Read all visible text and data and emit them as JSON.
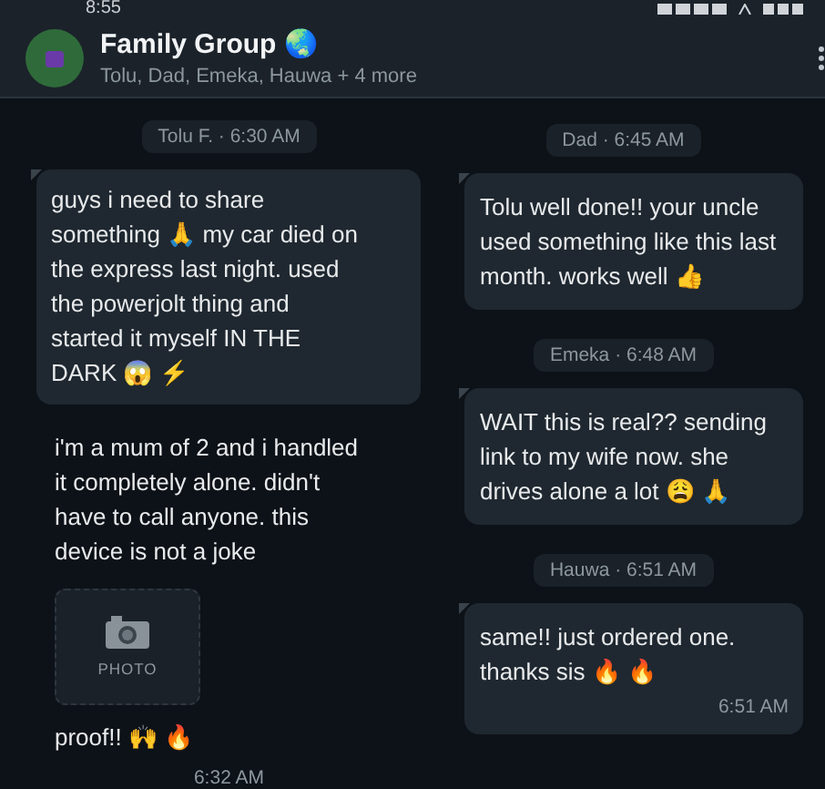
{
  "status_bar": {
    "time": "8:55"
  },
  "header": {
    "title": "Family Group 🌏",
    "subtitle": "Tolu, Dad, Emeka, Hauwa + 4 more"
  },
  "columns": [
    {
      "items": [
        {
          "kind": "stamp",
          "text": "Tolu F. · 6:30 AM"
        },
        {
          "kind": "bubble",
          "text": "guys i need to share something 🙏 my car died on the express last night. used the powerjolt thing and started it myself IN THE DARK 😱 ⚡"
        },
        {
          "kind": "text",
          "text": "i'm a mum of 2 and i handled it completely alone. didn't have to call anyone. this device is not a joke"
        },
        {
          "kind": "photo",
          "text": "PHOTO"
        },
        {
          "kind": "text",
          "text": "proof!! 🙌 🔥"
        },
        {
          "kind": "time",
          "text": "6:32 AM"
        }
      ]
    },
    {
      "items": [
        {
          "kind": "stamp",
          "text": "Dad · 6:45 AM"
        },
        {
          "kind": "bubble",
          "text": "Tolu well done!! your uncle used something like this last month. works well 👍"
        },
        {
          "kind": "stamp",
          "text": "Emeka · 6:48 AM"
        },
        {
          "kind": "bubble",
          "text": "WAIT this is real?? sending link to my wife now. she drives alone a lot 😩 🙏"
        },
        {
          "kind": "stamp",
          "text": "Hauwa · 6:51 AM"
        },
        {
          "kind": "bubble",
          "text": "same!! just ordered one. thanks sis 🔥 🔥",
          "time": "6:51 AM"
        }
      ]
    }
  ]
}
